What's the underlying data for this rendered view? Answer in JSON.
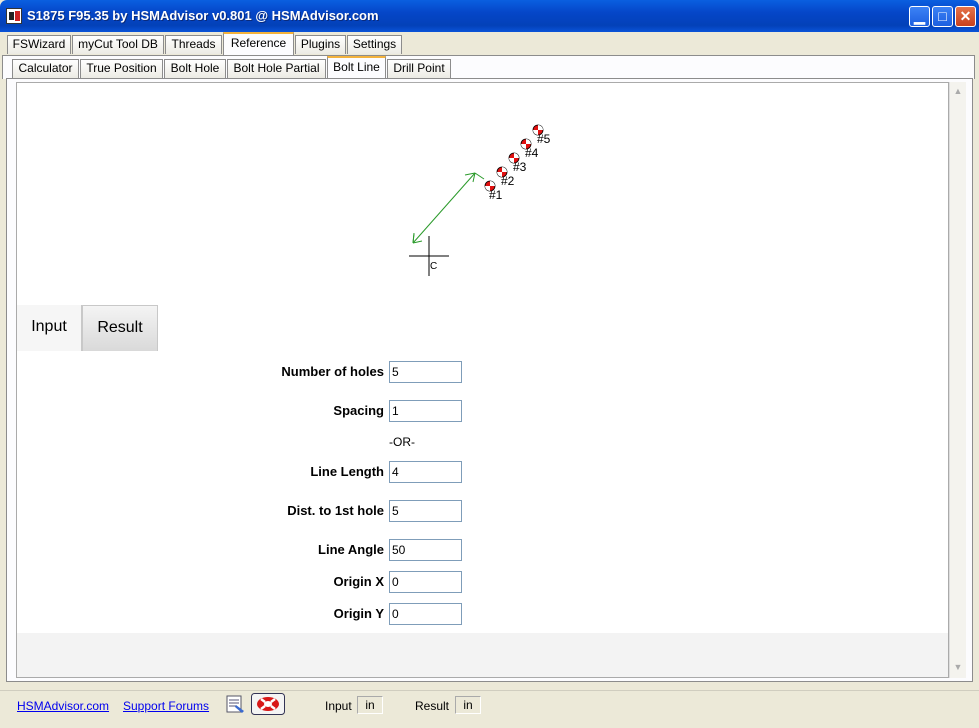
{
  "window": {
    "title": "S1875 F95.35 by HSMAdvisor v0.801 @ HSMAdvisor.com"
  },
  "main_tabs": [
    {
      "label": "FSWizard",
      "active": false
    },
    {
      "label": "myCut Tool DB",
      "active": false
    },
    {
      "label": "Threads",
      "active": false
    },
    {
      "label": "Reference",
      "active": true
    },
    {
      "label": "Plugins",
      "active": false
    },
    {
      "label": "Settings",
      "active": false
    }
  ],
  "sub_tabs": [
    {
      "label": "Calculator",
      "active": false
    },
    {
      "label": "True Position",
      "active": false
    },
    {
      "label": "Bolt Hole",
      "active": false
    },
    {
      "label": "Bolt Hole Partial",
      "active": false
    },
    {
      "label": "Bolt Line",
      "active": true
    },
    {
      "label": "Drill Point",
      "active": false
    }
  ],
  "drawing": {
    "origin_label": "C",
    "hole_labels": [
      "#1",
      "#2",
      "#3",
      "#4",
      "#5"
    ]
  },
  "view_tabs": {
    "input": "Input",
    "result": "Result"
  },
  "form": {
    "number_of_holes": {
      "label": "Number of holes",
      "value": "5"
    },
    "spacing": {
      "label": "Spacing",
      "value": "1"
    },
    "or_label": "-OR-",
    "line_length": {
      "label": "Line Length",
      "value": "4"
    },
    "dist_first_hole": {
      "label": "Dist. to 1st hole",
      "value": "5"
    },
    "line_angle": {
      "label": "Line Angle",
      "value": "50"
    },
    "origin_x": {
      "label": "Origin X",
      "value": "0"
    },
    "origin_y": {
      "label": "Origin Y",
      "value": "0"
    }
  },
  "status": {
    "site_link": "HSMAdvisor.com",
    "forums_link": "Support Forums",
    "input_label": "Input",
    "input_unit": "in",
    "result_label": "Result",
    "result_unit": "in"
  },
  "colors": {
    "hole_red": "#e01010",
    "arrow_green": "#2a9a2a"
  }
}
